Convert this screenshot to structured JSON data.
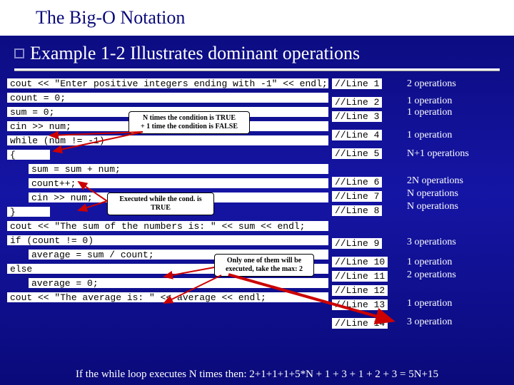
{
  "title": "The Big-O Notation",
  "subtitle": "Example 1-2  Illustrates dominant operations",
  "code": {
    "l1": "cout << \"Enter positive integers ending with -1\" << endl;",
    "l2": "count = 0;",
    "l3": "sum = 0;",
    "l4": "cin >> num;",
    "l5": "while (num != -1)",
    "l5b": "{",
    "l6": "sum = sum + num;",
    "l7": "count++;",
    "l8": "cin >> num;",
    "l8b": "}",
    "l9": "cout << \"The sum of the numbers is: \" << sum << endl;",
    "l10": "if (count != 0)",
    "l11": "average = sum / count;",
    "l12": "else",
    "l13": "average = 0;",
    "l14": "cout << \"The average is: \" << average << endl;"
  },
  "line_labels": {
    "l1": "//Line 1",
    "l2": "//Line 2",
    "l3": "//Line 3",
    "l4": "//Line 4",
    "l5": "//Line 5",
    "l6": "//Line 6",
    "l7": "//Line 7",
    "l8": "//Line 8",
    "l9": "//Line 9",
    "l10": "//Line 10",
    "l11": "//Line 11",
    "l12": "//Line 12",
    "l13": "//Line 13",
    "l14": "//Line 14"
  },
  "ops": {
    "o1": "2 operations",
    "o2": "1  operation",
    "o3": "1  operation",
    "o4": "1  operation",
    "o5": "N+1  operations",
    "o6": "2N  operations",
    "o7": "N  operations",
    "o8": "N  operations",
    "o9": "3  operations",
    "o10": "1  operation",
    "o11": "2  operations",
    "o13": "1  operation",
    "o14": "3  operation"
  },
  "callouts": {
    "c1a": "N times the condition is TRUE",
    "c1b": "+ 1 time the condition is FALSE",
    "c2a": "Executed while the cond. is",
    "c2b": "TRUE",
    "c3a": "Only one of them will be",
    "c3b": "executed, take the max: 2"
  },
  "footer": "If the while loop executes N times then: 2+1+1+1+5*N + 1 + 3 + 1 + 2 + 3  = 5N+15"
}
